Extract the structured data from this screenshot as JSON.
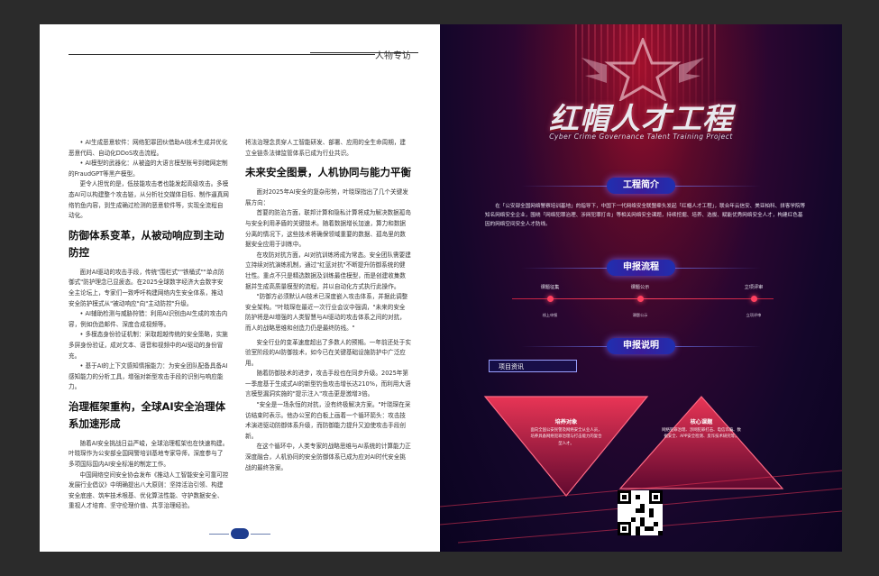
{
  "left_page": {
    "header_title": "人物专访",
    "page_number": "",
    "col1": {
      "bullet_a": "• AI生成恶意软件：网络犯罪团伙借助AI技术生成并优化恶意代码、自动化DDoS攻击流程。",
      "bullet_b": "• AI模型的武器化：从被盗的大语言模型账号到暗网定制的FraudGPT等黑产模型。",
      "para_a": "更令人担忧的是，低技能攻击者也能发起高级攻击。多模态AI可以构建整个攻击链，从分析社交媒体目标、制作逼真网络钓鱼内容，到生成确过检测的恶意软件等，实现全流程自动化。",
      "heading_a": "防御体系变革，从被动响应到主动防控",
      "para_b": "面对AI驱动的攻击手段，传统\"围栏式\"\"铁桶式\"\"单点防御式\"防护理念已显疲态。在2025全球数字经济大会数字安全主论坛上，专家们一致呼吁构建网络内生安全体系，推动安全防护模式从\"被动响应\"向\"主动防控\"升级。",
      "bullet_c": "• AI辅助检测与威胁狩猎：利用AI识别由AI生成的攻击内容，例如伪造邮件、深度合成视频等。",
      "bullet_d": "• 多模态身份验证机制：采取超越传统的安全策略，实施多屏身份验证，成对文本、语音和视频中的AI驱动的身份冒充。",
      "bullet_e": "• 基于AI的上下文感知情报能力：为安全团队配备具备AI感知能力的分析工具，增强对新型攻击手段的识别与响应能力。",
      "heading_b": "治理框架重构，全球AI安全治理体系加速形成",
      "para_c": "随着AI安全挑战日益严峻，全球治理框架也在快速构建。叶晓琛作为公安部全国网警培训基地专家导师，深度参与了多项国际国内AI安全标准的制定工作。",
      "para_d": "中国网络空间安全协会发布《推动人工智能安全可靠可控发展行业倡议》中明确提出八大原则：坚持活治引领、构建安全底座、筑牢技术根基、优化算法性能、守护数据安全、重视人才培育、坚守伦理价值、共享治理经验。"
    },
    "col2": {
      "para_a": "将法治理念贯穿人工智能研发、部署、应用的全生命周期，建立全链条法律监管体系已成为行业共识。",
      "heading_a": "未来安全图景，人机协同与能力平衡",
      "para_b": "面对2025年AI安全的复杂形势，叶晓琛指出了几个关键发展方向：",
      "para_c": "首要的防治方面，联邦计算和隐私计算将成为解决数据孤岛与安全利用矛盾的关键技术。随着数据增长加速，算力和数据分离的情况下，这些技术将确保领域重要的数据、孤岛里的数据安全应用于训练中。",
      "para_d": "在攻防对抗方面，AI对抗训练将成为常态。安全团队需要建立持续对抗演练机制，通过\"红蓝对抗\"不断提升防御系统的健壮性。重点不只是精选数据及训练最佳模型，而是创建收集数据并生成高质量模型的流程，并以自动化方式执行此操作。",
      "para_e": "\"防御方必须默认AI技术已深度嵌入攻击体系，并据此调整安全架构。\"叶晓琛在最近一次行业会议中强调，\"未来的安全防护将是AI增强的人类智慧与AI驱动的攻击体系之间的对抗，而人的战略思维和创造力仍是最终防线。\"",
      "para_f": "安全行业的变革速度超出了多数人的预期。一年前还处于实验室阶段的AI防御技术，如今已在关键基础设施防护中广泛应用。",
      "para_g": "随着防御技术的进步，攻击手段也在同步升级。2025年第一季度基于生成式AI的新型钓鱼攻击增长达210%，而利用大语言模型漏洞实施的\"提示注入\"攻击更是激增3倍。",
      "para_h": "\"安全是一场永恒的对抗，没有终极解决方案。\"叶晓琛在采访结束时表示。他办公室的白板上画着一个循环箭头：攻击技术演进驱动防御体系升级，而防御能力提升又迫使攻击手段创新。",
      "para_i": "在这个循环中，人类专家的战略思维与AI系统的计算能力正深度融合，人机协同的安全防御体系已成为应对AI时代安全挑战的最终答案。"
    }
  },
  "right_page": {
    "main_title": "红帽人才工程",
    "sub_title": "Cyber Crime Governance Talent Training Project",
    "section_intro_label": "工程简介",
    "intro_text": "在「公安部全国网络警察培训基地」的指导下，中国下一代网络安全联盟牵头发起「红帽人才工程」，联合年云信安、美亚柏科、拼客学院等知名网络安全企业，围绕「网络犯罪治理、涉网犯罪打击」等相关网络安全课题，持续挖掘、培养、选拔、赋能优秀网络安全人才，构建红色基因的网络空间安全人才防线。",
    "section_flow_label": "申报流程",
    "flow_steps": [
      {
        "label": "课题征集",
        "caption": "线上申报"
      },
      {
        "label": "课题公示",
        "caption": "课题公示"
      },
      {
        "label": "立项评审",
        "caption": "立项评审"
      }
    ],
    "section_apply_label": "申报说明",
    "project_tag": "项目资讯",
    "tri_left_head": "培养对象",
    "tri_left_text": "面向全国公安民警及网络安全从业人员，培养具备网络犯罪治理与打击能力的复合型人才。",
    "tri_right_head": "核心课题",
    "tri_right_text": "网络犯罪治理、涉网犯罪打击、电信诈骗、数据安全、APP安全检测、反诈技术研究等。",
    "colors": {
      "accent_red": "#ff2d55",
      "pill_blue": "#2a2fb8",
      "bg_dark": "#0a0420"
    }
  }
}
